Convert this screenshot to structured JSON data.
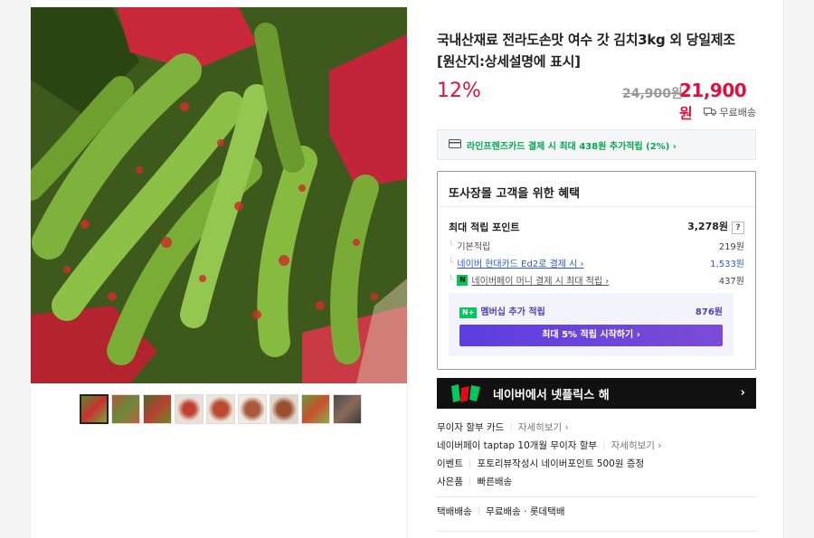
{
  "product": {
    "title": "국내산재료 전라도손맛 여수 갓 김치3kg 외 당일제조 [원산지:상세설명에 표시]",
    "discount": "12%",
    "original_price": "24,900원",
    "sale_price": "21,900",
    "sale_price_unit": "원",
    "shipping": "무료배송"
  },
  "card_benefit": "라인프렌즈카드 결제 시 최대 438원 추가적립 (2%) ›",
  "benefit_box": {
    "title": "또사장몰 고객을 위한 혜택",
    "max_points_label": "최대 적립 포인트",
    "max_points_value": "3,278원",
    "help": "?",
    "rows": [
      {
        "label": "기본적립",
        "value": "219원"
      },
      {
        "label": "네이버 현대카드 Ed2로 결제 시 ›",
        "value": "1,533원"
      },
      {
        "label": "네이버페이 머니 결제 시 최대 적립 ›",
        "value": "437원"
      }
    ],
    "membership_label": "멤버십 추가 적립",
    "membership_badge": "N+",
    "membership_value": "876원",
    "membership_button": "최대 5% 적립 시작하기 ›"
  },
  "banner": {
    "text": "네이버에서 넷플릭스 해",
    "chevron": "›"
  },
  "extras": [
    {
      "label": "무이자 할부 카드",
      "more": "자세히보기 ›"
    },
    {
      "label": "네이버페이 taptap 10개월 무이자 할부",
      "more": "자세히보기 ›"
    },
    {
      "label": "이벤트",
      "value": "포토리뷰작성시 네이버포인트 500원 증정"
    },
    {
      "label": "사은품",
      "value": "빠른배송"
    }
  ],
  "delivery": {
    "label": "택배배송",
    "value": "무료배송 · 롯데택배"
  },
  "thumbnails_count": 9,
  "colors": {
    "accent_red": "#e2103a",
    "naver_green": "#03c75a",
    "membership_purple": "#5b3ee0"
  }
}
